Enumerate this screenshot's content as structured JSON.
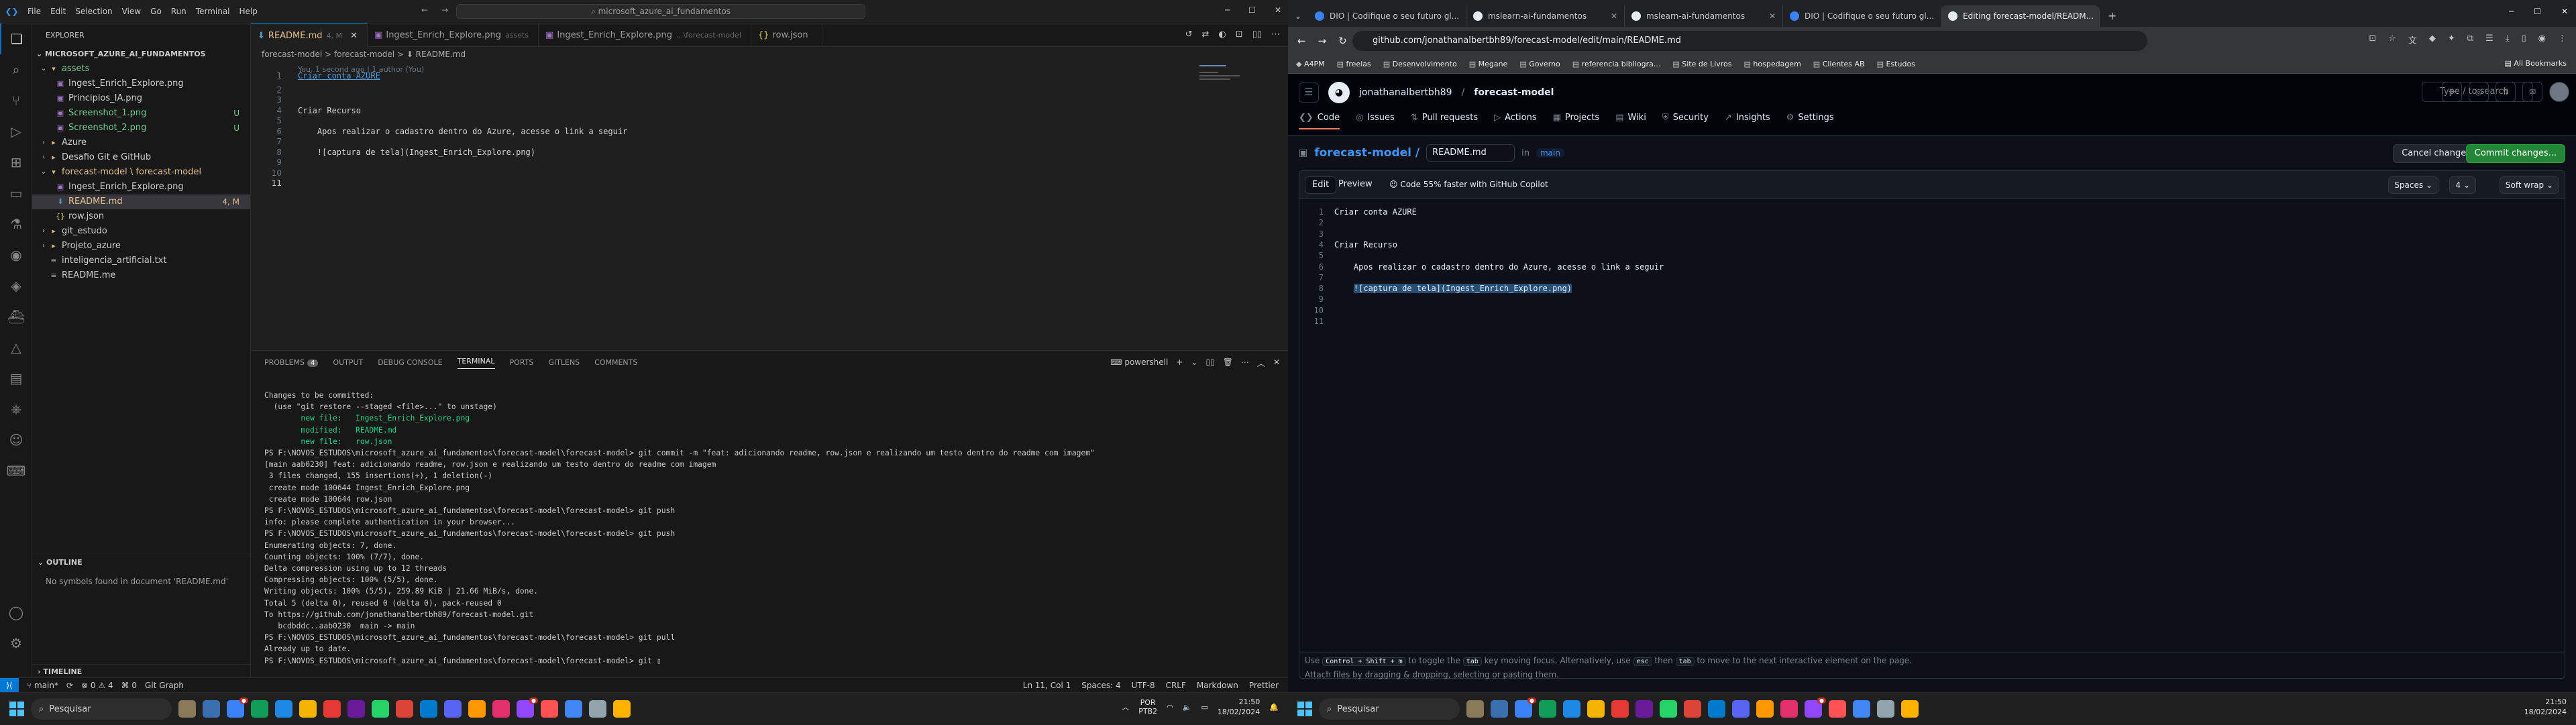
{
  "vscode": {
    "search_text": "microsoft_azure_ai_fundamentos",
    "menu": [
      "File",
      "Edit",
      "Selection",
      "View",
      "Go",
      "Run",
      "Terminal",
      "Help"
    ],
    "explorer_title": "EXPLORER",
    "root": "MICROSOFT_AZURE_AI_FUNDAMENTOS",
    "tree": [
      {
        "label": "assets",
        "type": "folder",
        "indent": 1,
        "status": "",
        "cls": "g"
      },
      {
        "label": "Ingest_Enrich_Explore.png",
        "type": "img",
        "indent": 2,
        "status": "",
        "cls": ""
      },
      {
        "label": "Principios_IA.png",
        "type": "img",
        "indent": 2,
        "status": "",
        "cls": ""
      },
      {
        "label": "Screenshot_1.png",
        "type": "img",
        "indent": 2,
        "status": "U",
        "cls": "g"
      },
      {
        "label": "Screenshot_2.png",
        "type": "img",
        "indent": 2,
        "status": "U",
        "cls": "g"
      },
      {
        "label": "Azure",
        "type": "folder-c",
        "indent": 1,
        "status": "",
        "cls": ""
      },
      {
        "label": "Desafio Git e GitHub",
        "type": "folder-c",
        "indent": 1,
        "status": "",
        "cls": ""
      },
      {
        "label": "forecast-model \\ forecast-model",
        "type": "folder",
        "indent": 1,
        "status": "",
        "cls": "m"
      },
      {
        "label": "Ingest_Enrich_Explore.png",
        "type": "img",
        "indent": 2,
        "status": "",
        "cls": ""
      },
      {
        "label": "README.md",
        "type": "md",
        "indent": 2,
        "status": "4, M",
        "cls": "m",
        "selected": true
      },
      {
        "label": "row.json",
        "type": "json",
        "indent": 2,
        "status": "",
        "cls": ""
      },
      {
        "label": "git_estudo",
        "type": "folder-c",
        "indent": 1,
        "status": "",
        "cls": ""
      },
      {
        "label": "Projeto_azure",
        "type": "folder-c",
        "indent": 1,
        "status": "",
        "cls": ""
      },
      {
        "label": "inteligencia_artificial.txt",
        "type": "txt",
        "indent": 1,
        "status": "",
        "cls": ""
      },
      {
        "label": "README.me",
        "type": "txt",
        "indent": 1,
        "status": "",
        "cls": ""
      }
    ],
    "outline_title": "OUTLINE",
    "outline_msg": "No symbols found in document 'README.md'",
    "timeline_title": "TIMELINE",
    "tabs": [
      {
        "label": "README.md",
        "hint": "4, M",
        "active": true
      },
      {
        "label": "Ingest_Enrich_Explore.png",
        "hint": "assets",
        "active": false
      },
      {
        "label": "Ingest_Enrich_Explore.png",
        "hint": "...\\forecast-model",
        "active": false
      },
      {
        "label": "row.json",
        "hint": "",
        "active": false
      }
    ],
    "breadcrumb": "forecast-model  >  forecast-model  >  ⬇ README.md",
    "blame": "You, 1 second ago | 1 author (You)",
    "lines": [
      {
        "n": "1",
        "text": "Criar conta AZURE",
        "style": "h1"
      },
      {
        "n": "2",
        "text": "",
        "style": ""
      },
      {
        "n": "3",
        "text": "",
        "style": ""
      },
      {
        "n": "4",
        "text": "Criar Recurso",
        "style": ""
      },
      {
        "n": "5",
        "text": "",
        "style": ""
      },
      {
        "n": "6",
        "text": "    Apos realizar o cadastro dentro do Azure, acesse o link a seguir",
        "style": ""
      },
      {
        "n": "7",
        "text": "",
        "style": ""
      },
      {
        "n": "8",
        "text": "    ![captura de tela](Ingest_Enrich_Explore.png)",
        "style": ""
      },
      {
        "n": "9",
        "text": "",
        "style": ""
      },
      {
        "n": "10",
        "text": "",
        "style": ""
      },
      {
        "n": "11",
        "text": "",
        "style": ""
      }
    ],
    "panel_tabs": [
      "PROBLEMS",
      "OUTPUT",
      "DEBUG CONSOLE",
      "TERMINAL",
      "PORTS",
      "GITLENS",
      "COMMENTS"
    ],
    "problems_count": "4",
    "terminal_shell": "powershell",
    "terminal": [
      {
        "t": "Changes to be committed:",
        "c": ""
      },
      {
        "t": "  (use \"git restore --staged <file>...\" to unstage)",
        "c": ""
      },
      {
        "t": "        new file:   Ingest_Enrich_Explore.png",
        "c": "tg"
      },
      {
        "t": "        modified:   README.md",
        "c": "tg"
      },
      {
        "t": "        new file:   row.json",
        "c": "tg"
      },
      {
        "t": "",
        "c": ""
      },
      {
        "t": "PS F:\\NOVOS_ESTUDOS\\microsoft_azure_ai_fundamentos\\forecast-model\\forecast-model> git commit -m \"feat: adicionando readme, row.json e realizando um testo dentro do readme com imagem\"",
        "c": ""
      },
      {
        "t": "[main aab0230] feat: adicionando readme, row.json e realizando um testo dentro do readme com imagem",
        "c": ""
      },
      {
        "t": " 3 files changed, 155 insertions(+), 1 deletion(-)",
        "c": ""
      },
      {
        "t": " create mode 100644 Ingest_Enrich_Explore.png",
        "c": ""
      },
      {
        "t": " create mode 100644 row.json",
        "c": ""
      },
      {
        "t": "PS F:\\NOVOS_ESTUDOS\\microsoft_azure_ai_fundamentos\\forecast-model\\forecast-model> git push",
        "c": ""
      },
      {
        "t": "info: please complete authentication in your browser...",
        "c": ""
      },
      {
        "t": "PS F:\\NOVOS_ESTUDOS\\microsoft_azure_ai_fundamentos\\forecast-model\\forecast-model> git push",
        "c": ""
      },
      {
        "t": "Enumerating objects: 7, done.",
        "c": ""
      },
      {
        "t": "Counting objects: 100% (7/7), done.",
        "c": ""
      },
      {
        "t": "Delta compression using up to 12 threads",
        "c": ""
      },
      {
        "t": "Compressing objects: 100% (5/5), done.",
        "c": ""
      },
      {
        "t": "Writing objects: 100% (5/5), 259.89 KiB | 21.66 MiB/s, done.",
        "c": ""
      },
      {
        "t": "Total 5 (delta 0), reused 0 (delta 0), pack-reused 0",
        "c": ""
      },
      {
        "t": "To https://github.com/jonathanalbertbh89/forecast-model.git",
        "c": ""
      },
      {
        "t": "   bcdbddc..aab0230  main -> main",
        "c": ""
      },
      {
        "t": "PS F:\\NOVOS_ESTUDOS\\microsoft_azure_ai_fundamentos\\forecast-model\\forecast-model> git pull",
        "c": ""
      },
      {
        "t": "Already up to date.",
        "c": ""
      },
      {
        "t": "PS F:\\NOVOS_ESTUDOS\\microsoft_azure_ai_fundamentos\\forecast-model\\forecast-model> git ▯",
        "c": ""
      }
    ],
    "status_left": {
      "branch": "main*",
      "sync": "⟳",
      "problems": "⊗ 0 ⚠ 4",
      "ports": "⌘ 0",
      "graph": "Git Graph"
    },
    "status_right": [
      "Ln 11, Col 1",
      "Spaces: 4",
      "UTF-8",
      "CRLF",
      "Markdown",
      "Prettier"
    ]
  },
  "taskbar": {
    "search": "Pesquisar",
    "lang1": "POR",
    "lang2": "PTB2",
    "time": "21:50",
    "date": "18/02/2024"
  },
  "browser": {
    "tabs": [
      {
        "label": "DIO | Codifique o seu futuro gl...",
        "color": "#3b82f6",
        "active": false
      },
      {
        "label": "mslearn-ai-fundamentos",
        "color": "#e6edf3",
        "active": false
      },
      {
        "label": "mslearn-ai-fundamentos",
        "color": "#e6edf3",
        "active": false
      },
      {
        "label": "DIO | Codifique o seu futuro gl...",
        "color": "#3b82f6",
        "active": false
      },
      {
        "label": "Editing forecast-model/READM...",
        "color": "#e6edf3",
        "active": true
      }
    ],
    "url": "github.com/jonathanalbertbh89/forecast-model/edit/main/README.md",
    "bookmarks": [
      "A4PM",
      "freelas",
      "Desenvolvimento",
      "Megane",
      "Governo",
      "referencia bibliogra...",
      "Site de Livros",
      "hospedagem",
      "Clientes AB",
      "Estudos"
    ],
    "all_bookmarks": "All Bookmarks"
  },
  "github": {
    "owner": "jonathanalbertbh89",
    "repo": "forecast-model",
    "search_placeholder": "Type / to search",
    "nav": [
      "Code",
      "Issues",
      "Pull requests",
      "Actions",
      "Projects",
      "Wiki",
      "Security",
      "Insights",
      "Settings"
    ],
    "crumb_repo": "forecast-model /",
    "filename": "README.md",
    "in_label": "in",
    "branch": "main",
    "cancel": "Cancel changes",
    "commit": "Commit changes...",
    "edit_tab": "Edit",
    "preview_tab": "Preview",
    "copilot": "Code 55% faster with GitHub Copilot",
    "indent_mode": "Spaces",
    "indent_size": "4",
    "wrap": "Soft wrap",
    "lines": [
      {
        "n": "1",
        "text": "Criar conta AZURE"
      },
      {
        "n": "2",
        "text": ""
      },
      {
        "n": "3",
        "text": ""
      },
      {
        "n": "4",
        "text": "Criar Recurso"
      },
      {
        "n": "5",
        "text": ""
      },
      {
        "n": "6",
        "text": "    Apos realizar o cadastro dentro do Azure, acesse o link a seguir"
      },
      {
        "n": "7",
        "text": ""
      },
      {
        "n": "8",
        "text": "    ![captura de tela](Ingest_Enrich_Explore.png)",
        "sel": true
      },
      {
        "n": "9",
        "text": ""
      },
      {
        "n": "10",
        "text": ""
      },
      {
        "n": "11",
        "text": ""
      }
    ],
    "footer_1a": "Use",
    "footer_keys": "Control + Shift + m",
    "footer_1b": "to toggle the",
    "footer_tab": "tab",
    "footer_1c": "key moving focus. Alternatively, use",
    "footer_esc": "esc",
    "footer_then": "then",
    "footer_tab2": "tab",
    "footer_1d": "to move to the next interactive element on the page.",
    "footer_2": "Attach files by dragging & dropping, selecting or pasting them."
  }
}
